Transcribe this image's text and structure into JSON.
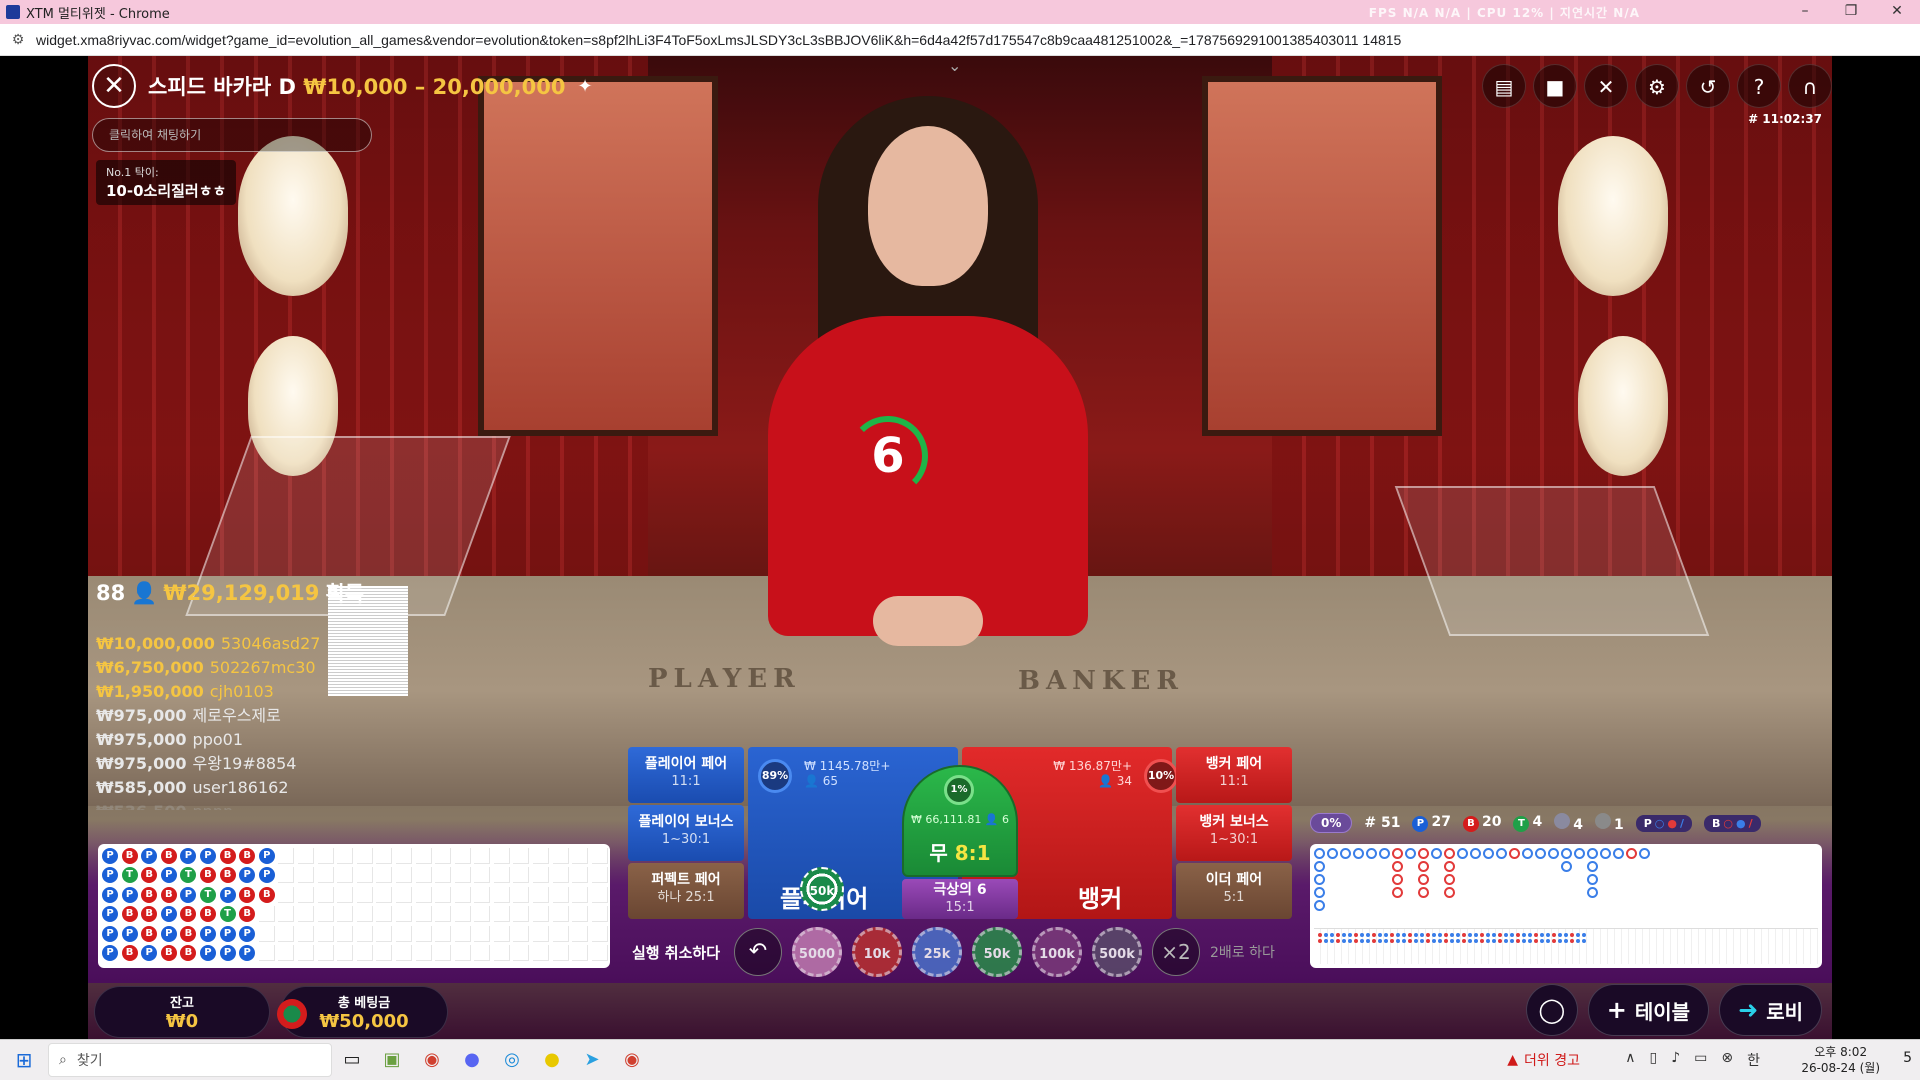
{
  "window": {
    "title": "XTM 멀티위젯 - Chrome",
    "url": "widget.xma8riyvac.com/widget?game_id=evolution_all_games&vendor=evolution&token=s8pf2lhLi3F4ToF5oxLmsJLSDY3cL3sBBJOV6liK&h=6d4a42f57d175547c8b9caa481251002&_=1787569291001385403011 14815",
    "stats": "FPS N/A N/A | CPU 12% | 지연시간 N/A",
    "minimize": "–",
    "maximize": "❐",
    "close": "✕"
  },
  "game": {
    "close_icon": "✕",
    "title": "스피드 바카라 D",
    "limits": "₩10,000 – 20,000,000",
    "pin_icon": "✦",
    "chat_placeholder": "클릭하여 채팅하기",
    "chat_message": {
      "user": "No.1 탁이:",
      "text": "10-0소리질러ㅎㅎ"
    },
    "game_id": "# 11:02:37",
    "timer": "6",
    "table_words": {
      "player": "PLAYER",
      "banker": "BANKER"
    },
    "toolbar_icons": [
      "chat-icon",
      "video-icon",
      "mute-icon",
      "gear-icon",
      "history-icon",
      "help-icon",
      "headset-icon"
    ]
  },
  "winners": {
    "count": "88",
    "total": "₩29,129,019",
    "suffix": "획득",
    "list": [
      {
        "amount": "₩10,000,000",
        "user": "53046asd27"
      },
      {
        "amount": "₩6,750,000",
        "user": "502267mc30"
      },
      {
        "amount": "₩1,950,000",
        "user": "cjh0103"
      },
      {
        "amount": "₩975,000",
        "user": "제로우스제로"
      },
      {
        "amount": "₩975,000",
        "user": "ppo01"
      },
      {
        "amount": "₩975,000",
        "user": "우왕19#8854"
      },
      {
        "amount": "₩585,000",
        "user": "user186162"
      },
      {
        "amount": "₩536,500",
        "user": "nnnn"
      }
    ]
  },
  "bead_road": {
    "rows": [
      [
        "P",
        "B",
        "P",
        "B",
        "P",
        "P",
        "B",
        "B",
        "P"
      ],
      [
        "P",
        "T",
        "B",
        "P",
        "T",
        "B",
        "B",
        "P",
        "P"
      ],
      [
        "P",
        "P",
        "B",
        "B",
        "P",
        "T",
        "P",
        "B",
        "B"
      ],
      [
        "P",
        "B",
        "B",
        "P",
        "B",
        "B",
        "T",
        "B",
        ""
      ],
      [
        "P",
        "P",
        "B",
        "P",
        "B",
        "P",
        "P",
        "P",
        ""
      ],
      [
        "P",
        "B",
        "P",
        "B",
        "B",
        "P",
        "P",
        "P",
        ""
      ]
    ]
  },
  "bets": {
    "player_pair": {
      "label": "플레이어 페어",
      "odds": "11:1"
    },
    "player_bonus": {
      "label": "플레이어 보너스",
      "odds": "1~30:1"
    },
    "perfect_pair": {
      "label": "퍼펙트 페어",
      "odds": "하나 25:1"
    },
    "player": {
      "label": "플레이어",
      "amount": "₩ 1145.78만+",
      "people": "👤 65",
      "pct": "89%"
    },
    "tie": {
      "label": "무",
      "odds": "8:1",
      "amount": "₩ 66,111.81",
      "people": "👤 6",
      "pct": "1%"
    },
    "banker": {
      "label": "뱅커",
      "amount": "₩ 136.87만+",
      "people": "👤 34",
      "pct": "10%"
    },
    "super6": {
      "label": "극상의 6",
      "odds": "15:1"
    },
    "banker_pair": {
      "label": "뱅커 페어",
      "odds": "11:1"
    },
    "banker_bonus": {
      "label": "뱅커 보너스",
      "odds": "1~30:1"
    },
    "either_pair": {
      "label": "이더 페어",
      "odds": "5:1"
    },
    "placed_chip": "50k"
  },
  "controls": {
    "undo_label": "실행 취소하다",
    "undo_icon": "↶",
    "chips": [
      "5000",
      "10k",
      "25k",
      "50k",
      "100k",
      "500k"
    ],
    "x2": "×2",
    "double_label": "2배로 하다"
  },
  "wallet": {
    "balance_label": "잔고",
    "balance": "₩0",
    "total_bet_label": "총 베팅금",
    "total_bet": "₩50,000"
  },
  "bottom_buttons": {
    "chat_icon": "◯",
    "add_table": "테이블",
    "add_icon": "+",
    "lobby": "로비",
    "lobby_icon": "➜"
  },
  "road_stats": {
    "pct": "0%",
    "round": "# 51",
    "player": "27",
    "banker": "20",
    "tie": "4",
    "player_pair": "4",
    "banker_pair": "1",
    "pred_player": "P",
    "pred_banker": "B"
  },
  "taskbar": {
    "search": "찾기",
    "heat_warning": "더위 경고",
    "time": "오후 8:02",
    "date": "26-08-24 (월)",
    "lang": "한",
    "notif": "5"
  }
}
